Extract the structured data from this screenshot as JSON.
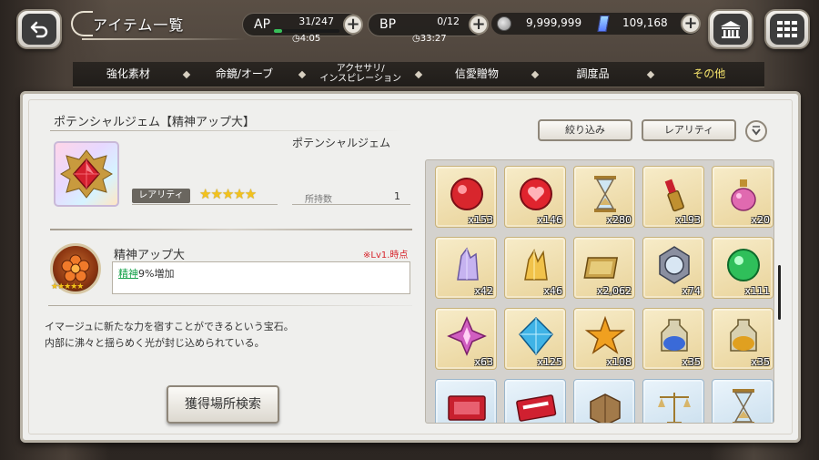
{
  "header": {
    "title": "アイテム一覧",
    "ap": {
      "label": "AP",
      "value": "31/247",
      "timer": "4:05",
      "fill": 0.13
    },
    "bp": {
      "label": "BP",
      "value": "0/12",
      "timer": "33:27",
      "fill": 0.0
    },
    "coins": "9,999,999",
    "gems": "109,168",
    "plus": "+",
    "icons": {
      "back": "back-arrow-icon",
      "shop": "shop-icon",
      "menu": "grid-menu-icon"
    }
  },
  "tabs": [
    {
      "label": "強化素材",
      "active": false
    },
    {
      "label": "命鏡/オーブ",
      "active": false
    },
    {
      "label": "アクセサリ/\nインスピレーション",
      "active": false
    },
    {
      "label": "信愛贈物",
      "active": false
    },
    {
      "label": "調度品",
      "active": false
    },
    {
      "label": "その他",
      "active": true
    }
  ],
  "detail": {
    "name": "ポテンシャルジェム【精神アップ大】",
    "type": "ポテンシャルジェム",
    "rarity_label": "レアリティ",
    "rarity_stars": 5,
    "stars_text": "★★★★★",
    "owned_label": "所持数",
    "owned_value": "1",
    "skill_name": "精神アップ大",
    "skill_lv": "※Lv1.時点",
    "skill_stat": "精神",
    "skill_effect": "9%増加",
    "skill_stars_text": "★★★★★",
    "description_line1": "イマージュに新たな力を宿すことができるという宝石。",
    "description_line2": "内部に沸々と揺らめく光が封じ込められている。",
    "acquire_button": "獲得場所検索"
  },
  "filters": {
    "narrow": "絞り込み",
    "rarity": "レアリティ"
  },
  "items": [
    {
      "icon": "red-gem-icon",
      "qty": "x153",
      "bg": "gold"
    },
    {
      "icon": "heart-orb-icon",
      "qty": "x146",
      "bg": "gold"
    },
    {
      "icon": "hourglass-icon",
      "qty": "x280",
      "bg": "gold"
    },
    {
      "icon": "lipstick-icon",
      "qty": "x193",
      "bg": "gold"
    },
    {
      "icon": "perfume-bottle-icon",
      "qty": "x20",
      "bg": "gold"
    },
    {
      "icon": "purple-crystal-icon",
      "qty": "x42",
      "bg": "gold"
    },
    {
      "icon": "gold-crystal-icon",
      "qty": "x46",
      "bg": "gold"
    },
    {
      "icon": "gold-plates-icon",
      "qty": "x2,062",
      "bg": "gold"
    },
    {
      "icon": "mirror-frame-icon",
      "qty": "x74",
      "bg": "gold"
    },
    {
      "icon": "green-orb-icon",
      "qty": "x111",
      "bg": "gold"
    },
    {
      "icon": "pink-star-gem-icon",
      "qty": "x63",
      "bg": "gold"
    },
    {
      "icon": "blue-diamond-icon",
      "qty": "x125",
      "bg": "gold"
    },
    {
      "icon": "gold-star-icon",
      "qty": "x108",
      "bg": "gold"
    },
    {
      "icon": "blue-vial-icon",
      "qty": "x35",
      "bg": "gold"
    },
    {
      "icon": "gold-vial-icon",
      "qty": "x35",
      "bg": "gold"
    },
    {
      "icon": "red-ticket-icon",
      "qty": "",
      "bg": "blue"
    },
    {
      "icon": "red-pass-icon",
      "qty": "",
      "bg": "blue"
    },
    {
      "icon": "book-box-icon",
      "qty": "",
      "bg": "blue"
    },
    {
      "icon": "scales-icon",
      "qty": "",
      "bg": "blue"
    },
    {
      "icon": "hourglass-icon",
      "qty": "",
      "bg": "blue"
    }
  ]
}
